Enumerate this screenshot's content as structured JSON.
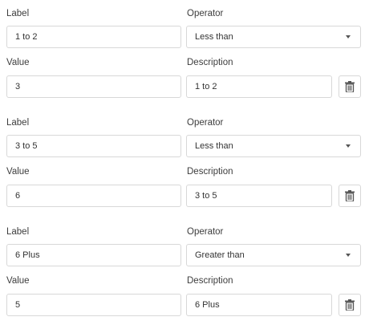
{
  "labels": {
    "label": "Label",
    "operator": "Operator",
    "value": "Value",
    "description": "Description"
  },
  "rules": [
    {
      "label": "1 to 2",
      "operator": "Less than",
      "value": "3",
      "description": "1 to 2"
    },
    {
      "label": "3 to 5",
      "operator": "Less than",
      "value": "6",
      "description": "3 to 5"
    },
    {
      "label": "6 Plus",
      "operator": "Greater than",
      "value": "5",
      "description": "6 Plus"
    }
  ],
  "icons": {
    "delete": "trash-icon",
    "dropdown": "chevron-down-icon"
  },
  "colors": {
    "border": "#d8d8d8",
    "text": "#333333",
    "icon": "#555555"
  }
}
